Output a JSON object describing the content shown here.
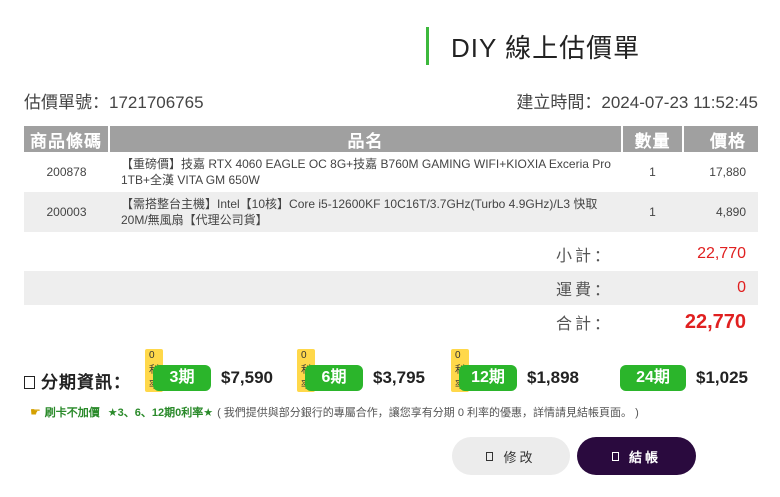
{
  "header": {
    "title": "DIY 線上估價單",
    "quote_number_label": "估價單號：",
    "quote_number": "1721706765",
    "created_label": "建立時間：",
    "created_time": "2024-07-23 11:52:45"
  },
  "table": {
    "headers": [
      "商品條碼",
      "品名",
      "數量",
      "價格"
    ],
    "rows": [
      {
        "code": "200878",
        "name": "【重磅價】技嘉 RTX 4060 EAGLE OC 8G+技嘉 B760M GAMING WIFI+KIOXIA Exceria Pro 1TB+全漢 VITA GM 650W",
        "qty": "1",
        "price": "17,880"
      },
      {
        "code": "200003",
        "name": "【需搭整台主機】Intel【10核】Core i5-12600KF 10C16T/3.7GHz(Turbo 4.9GHz)/L3 快取20M/無風扇【代理公司貨】",
        "qty": "1",
        "price": "4,890"
      }
    ]
  },
  "summary": {
    "subtotal_label": "小計：",
    "subtotal": "22,770",
    "shipping_label": "運費：",
    "shipping": "0",
    "total_label": "合計：",
    "total": "22,770"
  },
  "installment": {
    "label": "分期資訊：",
    "plans": [
      {
        "badge": "0利率",
        "period": "3期",
        "amount": "$7,590"
      },
      {
        "badge": "0利率",
        "period": "6期",
        "amount": "$3,795"
      },
      {
        "badge": "0利率",
        "period": "12期",
        "amount": "$1,898"
      },
      {
        "badge": "",
        "period": "24期",
        "amount": "$1,025"
      }
    ]
  },
  "note": {
    "tag": "刷卡不加價",
    "highlight": "★3、6、12期0利率★",
    "text": "( 我們提供與部分銀行的專屬合作，讓您享有分期 0 利率的優惠，詳情請見結帳頁面。 )"
  },
  "buttons": {
    "edit": "修改",
    "checkout": "結帳"
  },
  "colors": {
    "accent_green": "#2bb52b",
    "price_red": "#e02020",
    "checkout_purple": "#2a0a3e",
    "header_grey": "#a0a0a0"
  }
}
